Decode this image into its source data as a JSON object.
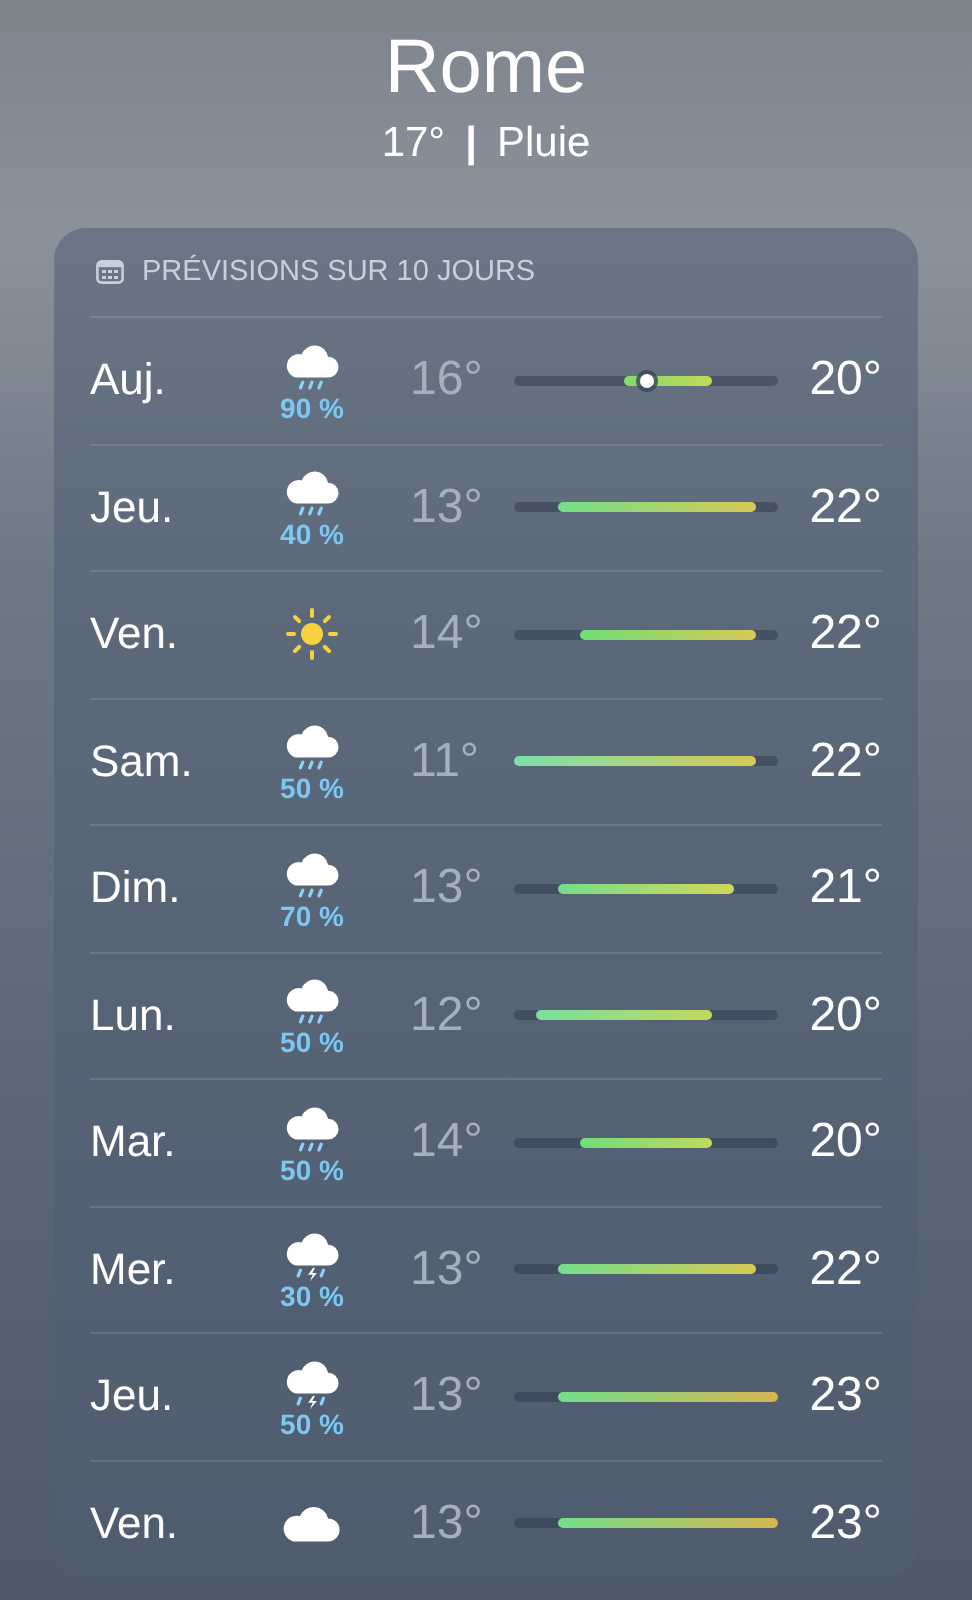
{
  "location": {
    "city": "Rome",
    "temperature": "17°",
    "separator": "|",
    "condition": "Pluie"
  },
  "forecast": {
    "title": "PRÉVISIONS SUR 10 JOURS",
    "days": [
      {
        "day": "Auj.",
        "kind": "rain",
        "precipitation": "90 %",
        "low": "16°",
        "high": "20°",
        "current_marker": true
      },
      {
        "day": "Jeu.",
        "kind": "rain",
        "precipitation": "40 %",
        "low": "13°",
        "high": "22°",
        "current_marker": false
      },
      {
        "day": "Ven.",
        "kind": "sun",
        "low": "14°",
        "high": "22°",
        "current_marker": false
      },
      {
        "day": "Sam.",
        "kind": "rain",
        "precipitation": "50 %",
        "low": "11°",
        "high": "22°",
        "current_marker": false
      },
      {
        "day": "Dim.",
        "kind": "rain",
        "precipitation": "70 %",
        "low": "13°",
        "high": "21°",
        "current_marker": false
      },
      {
        "day": "Lun.",
        "kind": "rain",
        "precipitation": "50 %",
        "low": "12°",
        "high": "20°",
        "current_marker": false
      },
      {
        "day": "Mar.",
        "kind": "rain",
        "precipitation": "50 %",
        "low": "14°",
        "high": "20°",
        "current_marker": false
      },
      {
        "day": "Mer.",
        "kind": "thunder",
        "precipitation": "30 %",
        "low": "13°",
        "high": "22°",
        "current_marker": false
      },
      {
        "day": "Jeu.",
        "kind": "thunder",
        "precipitation": "50 %",
        "low": "13°",
        "high": "23°",
        "current_marker": false
      },
      {
        "day": "Ven.",
        "kind": "cloud",
        "low": "13°",
        "high": "23°",
        "current_marker": false
      }
    ]
  }
}
